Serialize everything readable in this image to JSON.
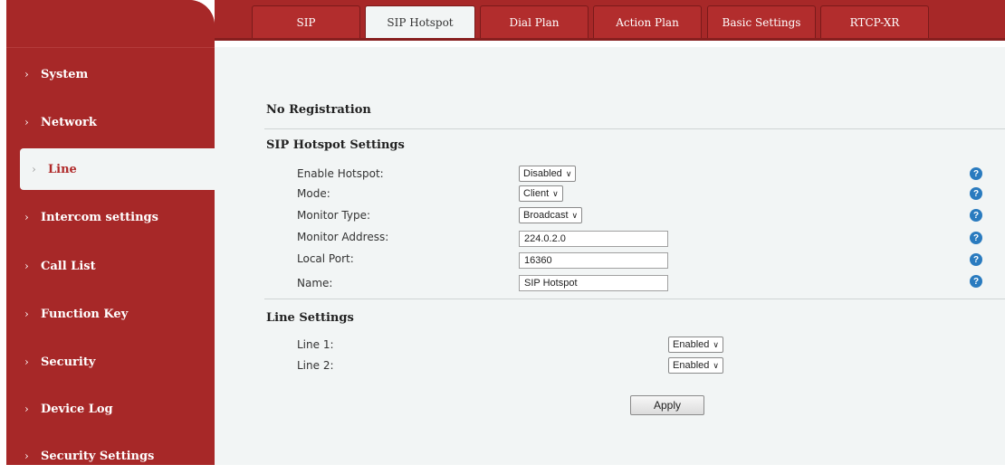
{
  "tabs": [
    "SIP",
    "SIP Hotspot",
    "Dial Plan",
    "Action Plan",
    "Basic Settings",
    "RTCP-XR"
  ],
  "sidebar": {
    "chevron": "›",
    "items": [
      "System",
      "Network",
      "Line",
      "Intercom settings",
      "Call List",
      "Function Key",
      "Security",
      "Device Log",
      "Security Settings"
    ]
  },
  "status": "No Registration",
  "hotspot": {
    "title": "SIP Hotspot Settings",
    "enable_label": "Enable Hotspot:",
    "enable_value": "Disabled",
    "mode_label": "Mode:",
    "mode_value": "Client",
    "monitor_type_label": "Monitor Type:",
    "monitor_type_value": "Broadcast",
    "monitor_address_label": "Monitor Address:",
    "monitor_address_value": "224.0.2.0",
    "local_port_label": "Local Port:",
    "local_port_value": "16360",
    "name_label": "Name:",
    "name_value": "SIP Hotspot"
  },
  "line_settings": {
    "title": "Line Settings",
    "line1_label": "Line 1:",
    "line1_value": "Enabled",
    "line2_label": "Line 2:",
    "line2_value": "Enabled"
  },
  "apply_label": "Apply",
  "dropdown_arrow": "∨",
  "help_glyph": "?",
  "colors": {
    "brand": "#a72828",
    "content_bg": "#f2f5f5",
    "help": "#2a7bbf"
  }
}
